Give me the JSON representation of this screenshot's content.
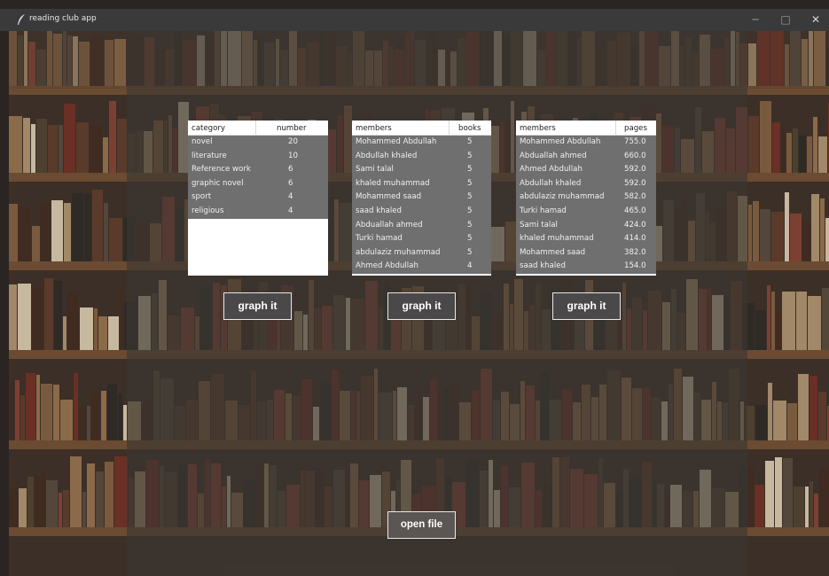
{
  "window": {
    "title": "reading club app",
    "min_symbol": "─",
    "max_symbol": "□",
    "close_symbol": "✕",
    "app_icon": "feather-icon"
  },
  "category_table": {
    "headers": [
      "category",
      "number"
    ],
    "rows": [
      [
        "novel",
        "20"
      ],
      [
        "literature",
        "10"
      ],
      [
        "Reference work",
        "6"
      ],
      [
        "graphic novel",
        "6"
      ],
      [
        "sport",
        "4"
      ],
      [
        "religious",
        "4"
      ]
    ]
  },
  "books_table": {
    "headers": [
      "members",
      "books"
    ],
    "rows": [
      [
        "Mohammed Abdullah",
        "5"
      ],
      [
        "Abdullah khaled",
        "5"
      ],
      [
        "Sami talal",
        "5"
      ],
      [
        "khaled muhammad",
        "5"
      ],
      [
        "Mohammed saad",
        "5"
      ],
      [
        "saad khaled",
        "5"
      ],
      [
        "Abduallah ahmed",
        "5"
      ],
      [
        "Turki hamad",
        "5"
      ],
      [
        "abdulaziz muhammad",
        "5"
      ],
      [
        "Ahmed Abdullah",
        "4"
      ]
    ]
  },
  "pages_table": {
    "headers": [
      "members",
      "pages"
    ],
    "rows": [
      [
        "Mohammed Abdullah",
        "755.0"
      ],
      [
        "Abduallah ahmed",
        "660.0"
      ],
      [
        "Ahmed Abdullah",
        "592.0"
      ],
      [
        "Abdullah khaled",
        "592.0"
      ],
      [
        "abdulaziz muhammad",
        "582.0"
      ],
      [
        "Turki hamad",
        "465.0"
      ],
      [
        "Sami talal",
        "424.0"
      ],
      [
        "khaled muhammad",
        "414.0"
      ],
      [
        "Mohammed saad",
        "382.0"
      ],
      [
        "saad khaled",
        "154.0"
      ]
    ]
  },
  "buttons": {
    "graph_label": "graph it",
    "open_label": "open file"
  },
  "colors": {
    "row_bg": "#6f6f6f",
    "header_bg": "#ffffff",
    "button_border": "#e9e9e9"
  }
}
